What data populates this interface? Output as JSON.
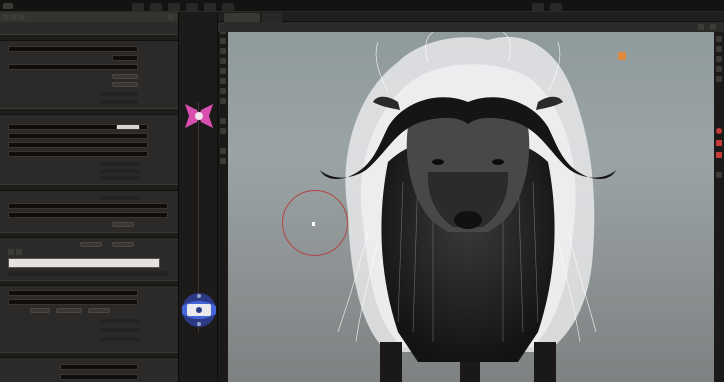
{
  "app": {
    "top_tabs": [
      {
        "label": ""
      },
      {
        "label": ""
      },
      {
        "label": ""
      },
      {
        "label": ""
      },
      {
        "label": ""
      },
      {
        "label": ""
      },
      {
        "label": ""
      },
      {
        "label": ""
      }
    ]
  },
  "parameters": {
    "color_field_value": "",
    "ramp_sections": [
      "",
      "",
      ""
    ]
  },
  "viewport": {
    "mode_label": "",
    "camera_label": "",
    "info_title": "",
    "info_subtitle": "",
    "stats": [
      {
        "label": "",
        "value": ""
      },
      {
        "label": "",
        "value": ""
      },
      {
        "label": "",
        "value": ""
      },
      {
        "label": "",
        "value": ""
      },
      {
        "label": "",
        "value": ""
      },
      {
        "label": "",
        "value": ""
      },
      {
        "label": "",
        "value": ""
      },
      {
        "label": "",
        "value": ""
      },
      {
        "label": "",
        "value": ""
      },
      {
        "label": "",
        "value": ""
      },
      {
        "label": "",
        "value": ""
      },
      {
        "label": "",
        "value": ""
      }
    ]
  },
  "colors": {
    "node_pink": "#d94fb0",
    "node_blue": "#4566d9",
    "brush_circle": "#b24545",
    "viewport_bg": "#8f9a9c"
  },
  "icons": [
    "grid-icon",
    "save-icon",
    "camera-icon",
    "brush-icon",
    "light-icon",
    "display-icon",
    "select-icon",
    "move-icon",
    "rotate-icon",
    "scale-icon",
    "render-icon",
    "close-icon"
  ]
}
